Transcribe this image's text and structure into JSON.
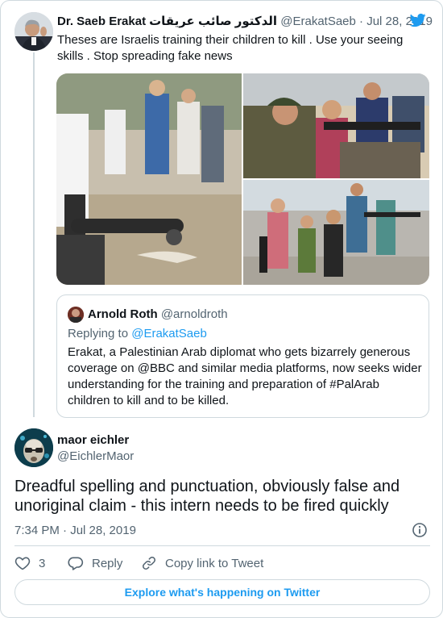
{
  "parent_tweet": {
    "author_name": "Dr. Saeb Erakat",
    "author_name_arabic": "الدكتور صائب عريقات",
    "handle": "@ErakatSaeb",
    "separator": "·",
    "date": "Jul 28, 2019",
    "text": "Theses are Israelis training their children to kill . Use your seeing skills . Stop spreading fake news"
  },
  "quoted_tweet": {
    "author_name": "Arnold Roth",
    "handle": "@arnoldroth",
    "replying_to_prefix": "Replying to",
    "replying_to_handle": "@ErakatSaeb",
    "text": "Erakat, a Palestinian Arab diplomat who gets bizarrely generous coverage on @BBC and similar media platforms, now seeks wider understanding for the training and preparation of #PalArab children to kill and to be killed."
  },
  "main_tweet": {
    "author_name": "maor eichler",
    "handle": "@EichlerMaor",
    "text": "Dreadful spelling and punctuation, obviously false and unoriginal claim - this intern needs to be fired quickly",
    "timestamp": "7:34 PM · Jul 28, 2019"
  },
  "actions": {
    "like_count": "3",
    "reply_label": "Reply",
    "copy_link_label": "Copy link to Tweet"
  },
  "explore_label": "Explore what's happening on Twitter",
  "icons": {
    "brand": "twitter-bird-icon",
    "info": "info-icon",
    "like": "heart-icon",
    "reply": "reply-bubble-icon",
    "copy": "link-icon"
  },
  "colors": {
    "accent": "#1d9bf0",
    "text": "#0f1419",
    "secondary": "#536471",
    "border": "#cfd9de"
  }
}
